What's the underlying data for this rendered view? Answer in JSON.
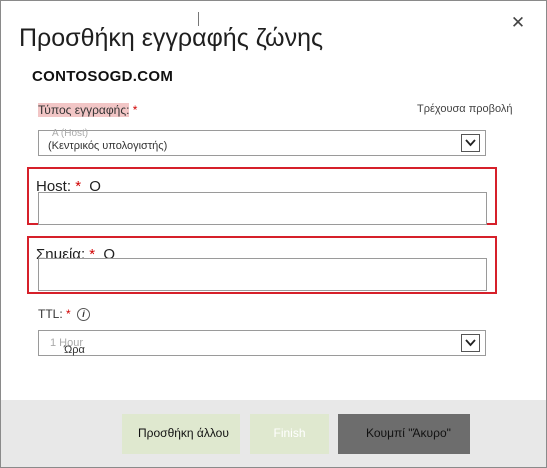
{
  "dialog": {
    "title": "Προσθήκη εγγραφής ζώνης",
    "zone": "CONTOSOGD.COM"
  },
  "record_type": {
    "label": "Τύπος εγγραφής:",
    "required_mark": "*",
    "current_view_link": "Τρέχουσα προβολή",
    "ghost_value": "A (Host)",
    "value": "(Κεντρικός υπολογιστής)"
  },
  "host": {
    "label": "Host:",
    "required_mark": "*",
    "suffix": "Ο",
    "value": ""
  },
  "points_to": {
    "label": "Σημεία:",
    "required_mark": "*",
    "suffix": "Ο",
    "value": ""
  },
  "ttl": {
    "label": "TTL:",
    "required_mark": "*",
    "ghost_value": "1 Hour",
    "value": "Ώρα"
  },
  "footer": {
    "add_another_label": "Προσθήκη άλλου",
    "finish_label": "Finish",
    "cancel_label": "Κουμπί \"Άκυρο\""
  },
  "icons": {
    "close": "close-icon",
    "chevron": "chevron-down-icon",
    "info": "info-icon"
  }
}
